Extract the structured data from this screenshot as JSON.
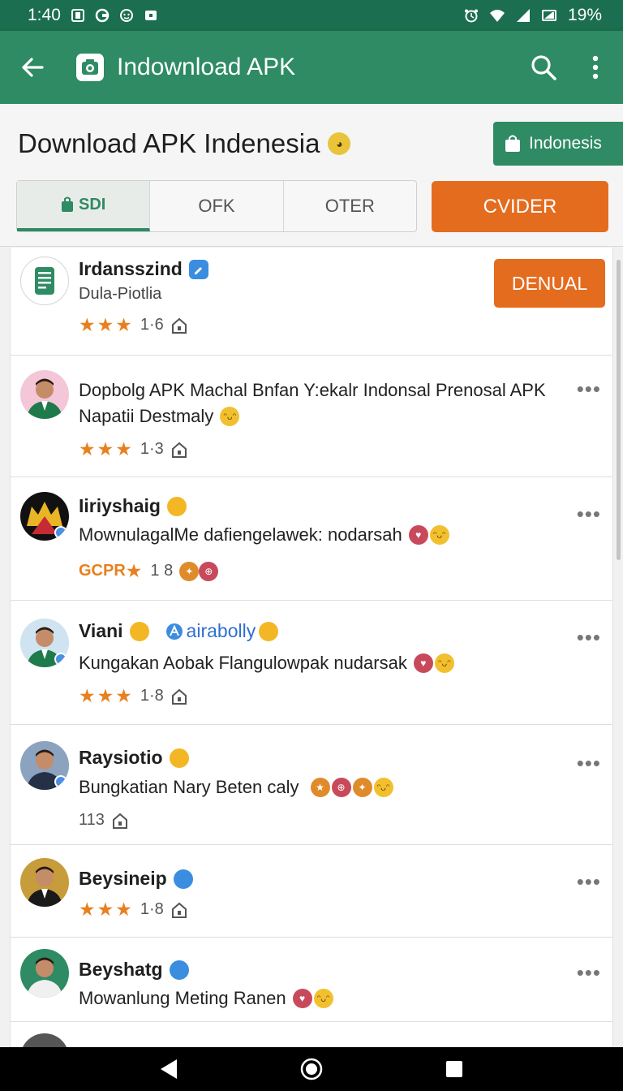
{
  "status_bar": {
    "time": "1:40",
    "battery": "19%"
  },
  "app_bar": {
    "title": "Indownload APK"
  },
  "header": {
    "page_title": "Download APK Indenesia",
    "country_button": "Indonesis",
    "tabs": [
      {
        "label": "SDI",
        "active": true
      },
      {
        "label": "OFK",
        "active": false
      },
      {
        "label": "OTER",
        "active": false
      }
    ],
    "provider_button": "CVIDER"
  },
  "list": [
    {
      "name": "Irdansszind",
      "subtitle": "Dula-Piotlia",
      "rating": "1·6",
      "action": "DENUAL"
    },
    {
      "name": "",
      "text_line1": "Dopbolg APK Machal Bnfan Y:ekalr Indonsal Prenosal APK",
      "text_line2": "Napatii Destmaly",
      "rating": "1·3"
    },
    {
      "name": "Iiriyshaig",
      "desc": "MownulagalMe dafiengelawek: nodarsah",
      "badge_text": "GCPR",
      "rating": "1 8"
    },
    {
      "name": "Viani",
      "link": "airabolly",
      "desc": "Kungakan Aobak Flangulowpak nudarsak",
      "rating": "1·8"
    },
    {
      "name": "Raysiotio",
      "desc": "Bungkatian Nary Beten caly",
      "rating": "113"
    },
    {
      "name": "Beysineip",
      "rating": "1·8"
    },
    {
      "name": "Beyshatg",
      "desc": "Mowanlung Meting Ranen"
    }
  ],
  "colors": {
    "primary": "#2e8b63",
    "status_bar": "#1b6e4f",
    "accent_orange": "#e46c1f",
    "star": "#e8801f"
  }
}
